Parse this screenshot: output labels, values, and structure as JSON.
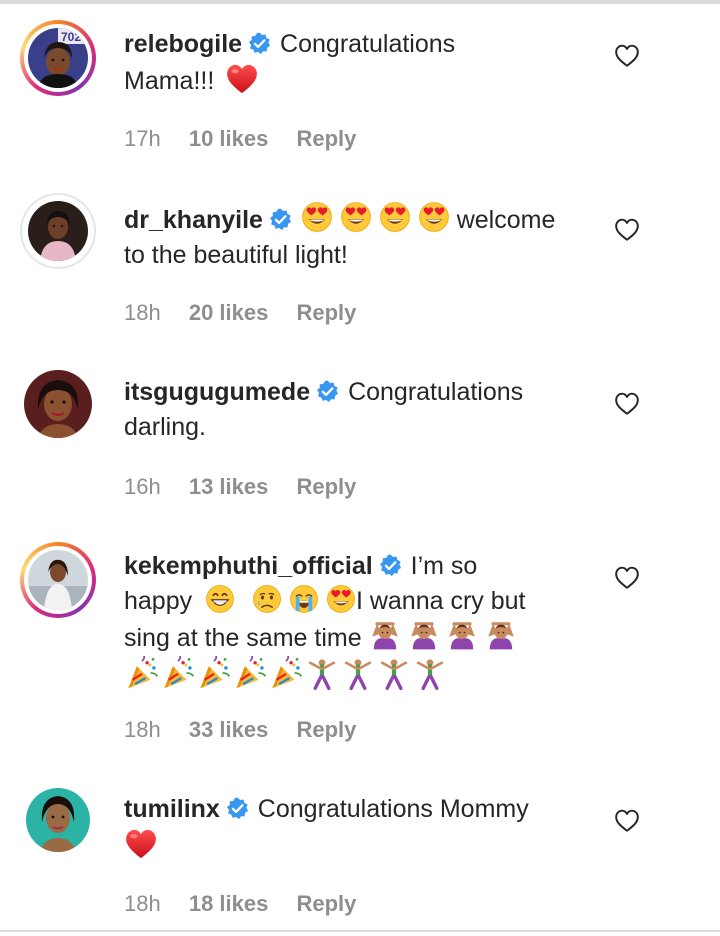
{
  "comments": [
    {
      "username": "relebogile",
      "text": "Congratulations",
      "text2": "Mama!!!",
      "time": "17h",
      "likes": "10 likes",
      "reply": "Reply",
      "avatar_badge": "702"
    },
    {
      "username": "dr_khanyile",
      "text": "welcome",
      "text2": "to the beautiful light!",
      "time": "18h",
      "likes": "20 likes",
      "reply": "Reply"
    },
    {
      "username": "itsgugugumede",
      "text": "Congratulations",
      "text2": "darling.",
      "time": "16h",
      "likes": "13 likes",
      "reply": "Reply"
    },
    {
      "username": "kekemphuthi_official",
      "text": "I’m so",
      "text2a": "happy",
      "text2b": "I wanna cry but",
      "text3": "sing at the same time",
      "time": "18h",
      "likes": "33 likes",
      "reply": "Reply"
    },
    {
      "username": "tumilinx",
      "text": "Congratulations Mommy",
      "time": "18h",
      "likes": "18 likes",
      "reply": "Reply"
    }
  ],
  "colors": {
    "text": "#262626",
    "meta": "#8e8e8e",
    "verified": "#3897f0",
    "heart_red": "#e0262c"
  },
  "icons": [
    "verified-badge-icon",
    "heart-outline-icon",
    "red-heart-emoji",
    "heart-eyes-emoji",
    "grinning-emoji",
    "crying-emoji",
    "sobbing-emoji",
    "person-gesturing-no-emoji",
    "party-popper-emoji",
    "cartwheel-emoji"
  ]
}
